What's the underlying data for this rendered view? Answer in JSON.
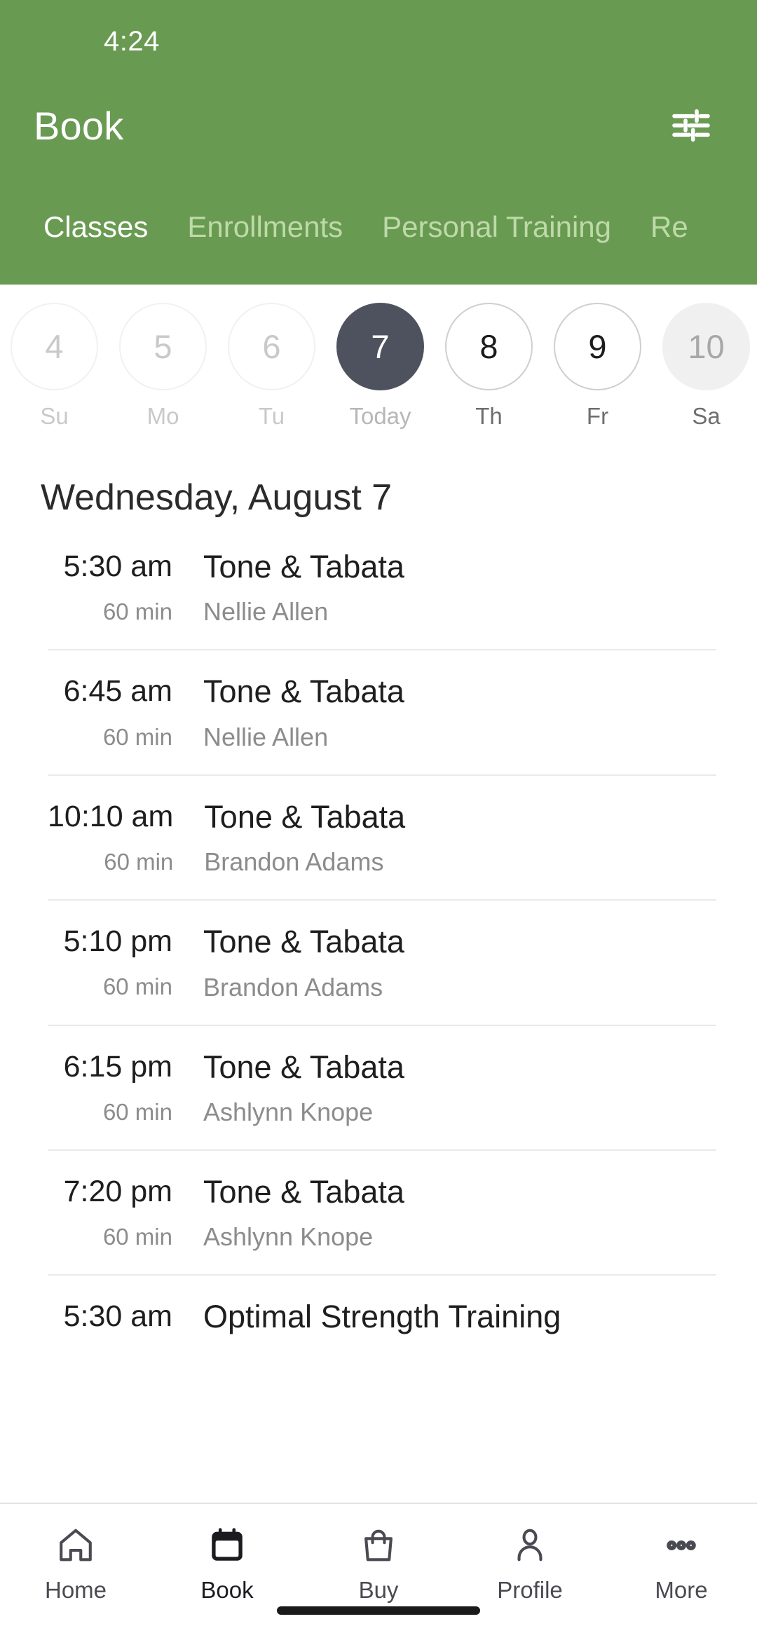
{
  "status_bar": {
    "time": "4:24"
  },
  "header": {
    "title": "Book",
    "filter_icon": "tune-icon",
    "background_color": "#699A51",
    "tabs": [
      {
        "label": "Classes",
        "active": true
      },
      {
        "label": "Enrollments",
        "active": false
      },
      {
        "label": "Personal Training",
        "active": false
      },
      {
        "label": "Re",
        "active": false
      }
    ]
  },
  "date_strip": {
    "days": [
      {
        "date": "4",
        "weekday": "Su",
        "state": "past"
      },
      {
        "date": "5",
        "weekday": "Mo",
        "state": "past"
      },
      {
        "date": "6",
        "weekday": "Tu",
        "state": "past"
      },
      {
        "date": "7",
        "weekday": "Today",
        "state": "today"
      },
      {
        "date": "8",
        "weekday": "Th",
        "state": "avail"
      },
      {
        "date": "9",
        "weekday": "Fr",
        "state": "avail"
      },
      {
        "date": "10",
        "weekday": "Sa",
        "state": "filled"
      }
    ],
    "selected_color": "#4E525E"
  },
  "schedule": {
    "day_heading": "Wednesday, August 7",
    "classes": [
      {
        "time": "5:30 am",
        "duration": "60 min",
        "name": "Tone & Tabata",
        "instructor": "Nellie Allen"
      },
      {
        "time": "6:45 am",
        "duration": "60 min",
        "name": "Tone & Tabata",
        "instructor": "Nellie Allen"
      },
      {
        "time": "10:10 am",
        "duration": "60 min",
        "name": "Tone & Tabata",
        "instructor": "Brandon Adams"
      },
      {
        "time": "5:10 pm",
        "duration": "60 min",
        "name": "Tone & Tabata",
        "instructor": "Brandon Adams"
      },
      {
        "time": "6:15 pm",
        "duration": "60 min",
        "name": "Tone & Tabata",
        "instructor": "Ashlynn Knope"
      },
      {
        "time": "7:20 pm",
        "duration": "60 min",
        "name": "Tone & Tabata",
        "instructor": "Ashlynn Knope"
      },
      {
        "time": "5:30 am",
        "duration": "",
        "name": "Optimal Strength Training",
        "instructor": ""
      }
    ]
  },
  "bottom_nav": {
    "items": [
      {
        "label": "Home",
        "icon": "home-icon",
        "active": false
      },
      {
        "label": "Book",
        "icon": "calendar-icon",
        "active": true
      },
      {
        "label": "Buy",
        "icon": "bag-icon",
        "active": false
      },
      {
        "label": "Profile",
        "icon": "person-icon",
        "active": false
      },
      {
        "label": "More",
        "icon": "dots-icon",
        "active": false
      }
    ]
  }
}
